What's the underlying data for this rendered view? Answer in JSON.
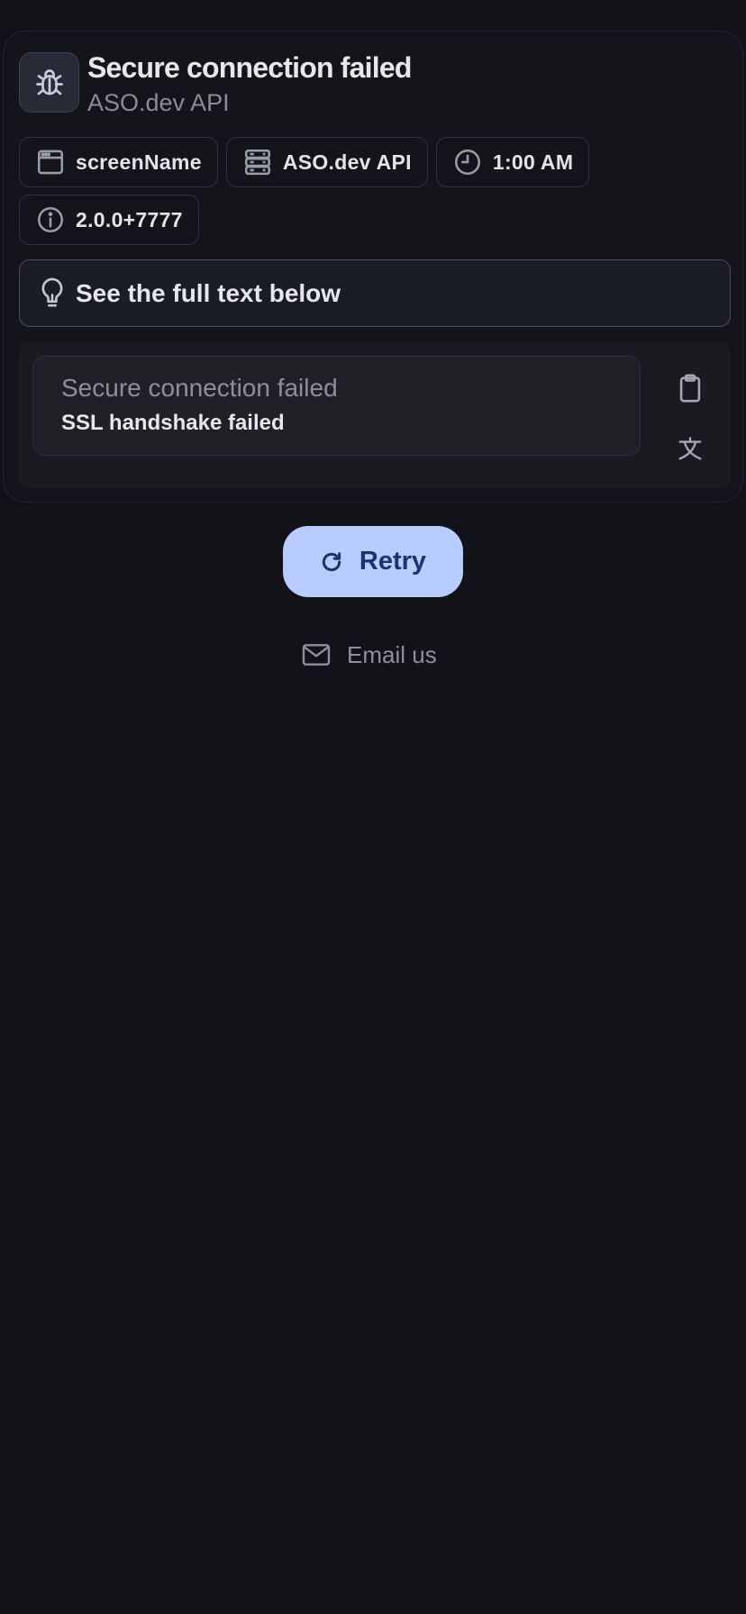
{
  "error": {
    "title": "Secure connection failed",
    "subtitle": "ASO.dev API",
    "icon": "bug-icon"
  },
  "chips": [
    {
      "icon": "window-icon",
      "label": "screenName"
    },
    {
      "icon": "server-icon",
      "label": "ASO.dev API"
    },
    {
      "icon": "clock-icon",
      "label": "1:00 AM"
    },
    {
      "icon": "info-icon",
      "label": "2.0.0+7777"
    }
  ],
  "hint": {
    "icon": "lightbulb-icon",
    "text": "See the full text below"
  },
  "message": {
    "title": "Secure connection failed",
    "detail": "SSL handshake failed",
    "actions": [
      "clipboard-icon",
      "translate-icon"
    ]
  },
  "retry": {
    "icon": "refresh-icon",
    "label": "Retry"
  },
  "email": {
    "icon": "mail-icon",
    "label": "Email us"
  },
  "colors": {
    "background": "#121319",
    "primary_button": "#b8ccff",
    "primary_text": "#1d3270",
    "muted_text": "#8f9097"
  }
}
